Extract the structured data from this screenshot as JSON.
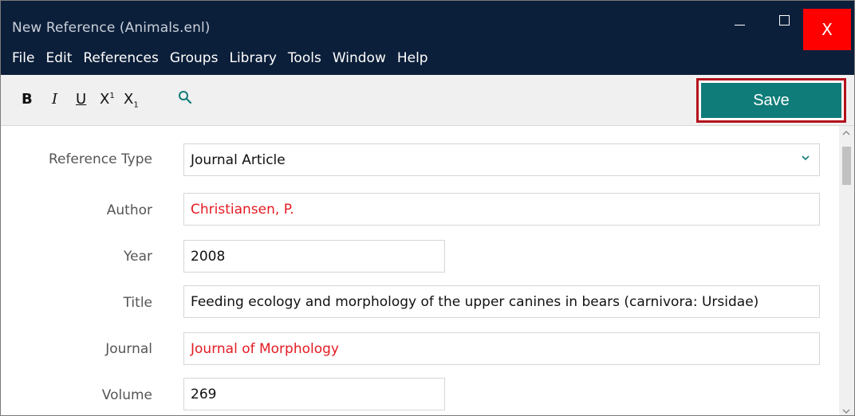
{
  "window": {
    "title": "New Reference (Animals.enl)",
    "close_label": "X"
  },
  "menu": [
    "File",
    "Edit",
    "References",
    "Groups",
    "Library",
    "Tools",
    "Window",
    "Help"
  ],
  "toolbar": {
    "bold": "B",
    "italic": "I",
    "underline": "U",
    "superscript_base": "X",
    "superscript": "1",
    "subscript_base": "X",
    "subscript": "1",
    "save_label": "Save"
  },
  "form": {
    "reference_type": {
      "label": "Reference Type",
      "value": "Journal Article"
    },
    "author": {
      "label": "Author",
      "value": "Christiansen, P."
    },
    "year": {
      "label": "Year",
      "value": "2008"
    },
    "title": {
      "label": "Title",
      "value": "Feeding ecology and morphology of the upper canines in bears (carnivora: Ursidae)"
    },
    "journal": {
      "label": "Journal",
      "value": "Journal of Morphology"
    },
    "volume": {
      "label": "Volume",
      "value": "269"
    }
  },
  "colors": {
    "titlebar": "#0c1f3a",
    "save_button": "#0f7c79",
    "save_highlight": "#b3121c",
    "close_button": "#ff0000",
    "red_text": "#e31b23"
  }
}
